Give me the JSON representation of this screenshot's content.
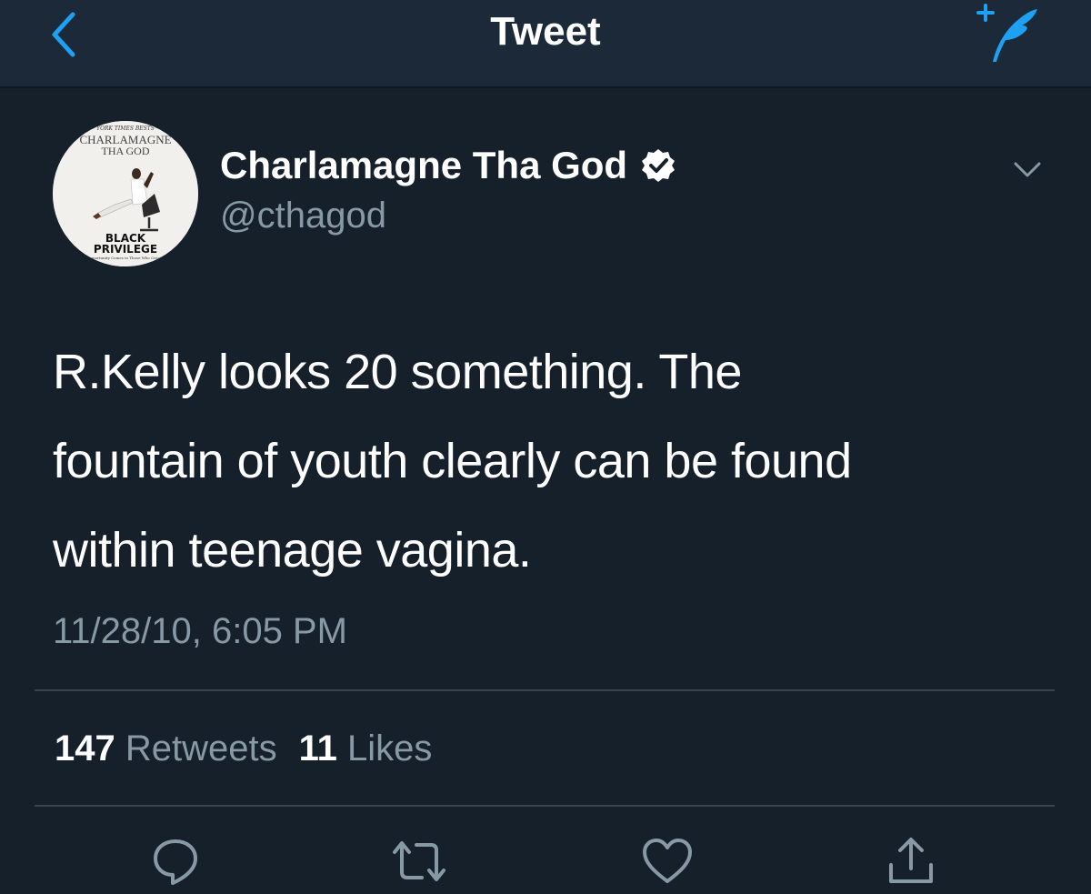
{
  "header": {
    "title": "Tweet",
    "back_icon": "chevron-left-icon",
    "compose_icon": "compose-quill-icon"
  },
  "author": {
    "display_name": "Charlamagne Tha God",
    "handle": "@cthagod",
    "verified": true,
    "avatar_texts": {
      "top_banner": "YORK TIMES BESTS",
      "author_line1": "CHARLAMAGNE",
      "author_line2": "THA GOD",
      "book_title_line1": "BLACK",
      "book_title_line2": "PRIVILEGE",
      "book_subtitle": "Opportunity Comes to Those Who Create"
    }
  },
  "tweet": {
    "lines": [
      "R.Kelly looks 20 something. The",
      "fountain of youth clearly can be found",
      "within teenage vagina."
    ],
    "timestamp": "11/28/10, 6:05 PM"
  },
  "stats": {
    "retweets_count": "147",
    "retweets_label": "Retweets",
    "likes_count": "11",
    "likes_label": "Likes"
  },
  "actions": [
    "reply-icon",
    "retweet-icon",
    "like-icon",
    "share-icon"
  ],
  "colors": {
    "accent": "#1da1f2",
    "background": "#15202b",
    "header": "#1c2938",
    "secondary_text": "#8899a6",
    "divider": "#38444d"
  }
}
